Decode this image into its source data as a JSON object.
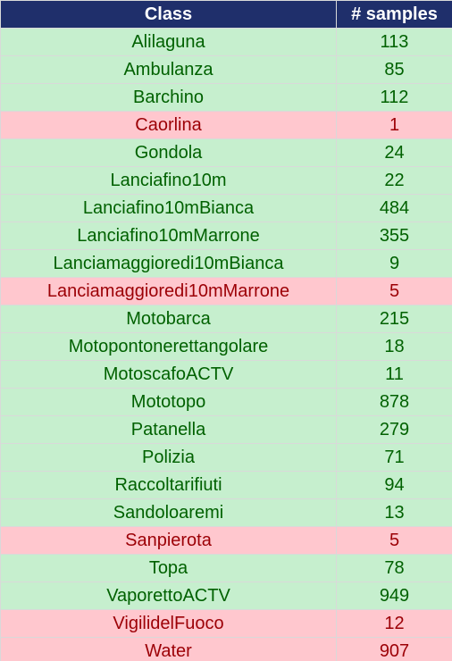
{
  "header": {
    "class_label": "Class",
    "samples_label": "# samples"
  },
  "colors": {
    "header_bg": "#1f2f6b",
    "good_bg": "#c6efce",
    "good_text": "#006100",
    "bad_bg": "#ffc7ce",
    "bad_text": "#9c0006"
  },
  "rows": [
    {
      "class": "Alilaguna",
      "samples": "113",
      "status": "good"
    },
    {
      "class": "Ambulanza",
      "samples": "85",
      "status": "good"
    },
    {
      "class": "Barchino",
      "samples": "112",
      "status": "good"
    },
    {
      "class": "Caorlina",
      "samples": "1",
      "status": "bad"
    },
    {
      "class": "Gondola",
      "samples": "24",
      "status": "good"
    },
    {
      "class": "Lanciafino10m",
      "samples": "22",
      "status": "good"
    },
    {
      "class": "Lanciafino10mBianca",
      "samples": "484",
      "status": "good"
    },
    {
      "class": "Lanciafino10mMarrone",
      "samples": "355",
      "status": "good"
    },
    {
      "class": "Lanciamaggioredi10mBianca",
      "samples": "9",
      "status": "good"
    },
    {
      "class": "Lanciamaggioredi10mMarrone",
      "samples": "5",
      "status": "bad"
    },
    {
      "class": "Motobarca",
      "samples": "215",
      "status": "good"
    },
    {
      "class": "Motopontonerettangolare",
      "samples": "18",
      "status": "good"
    },
    {
      "class": "MotoscafoACTV",
      "samples": "11",
      "status": "good"
    },
    {
      "class": "Mototopo",
      "samples": "878",
      "status": "good"
    },
    {
      "class": "Patanella",
      "samples": "279",
      "status": "good"
    },
    {
      "class": "Polizia",
      "samples": "71",
      "status": "good"
    },
    {
      "class": "Raccoltarifiuti",
      "samples": "94",
      "status": "good"
    },
    {
      "class": "Sandoloaremi",
      "samples": "13",
      "status": "good"
    },
    {
      "class": "Sanpierota",
      "samples": "5",
      "status": "bad"
    },
    {
      "class": "Topa",
      "samples": "78",
      "status": "good"
    },
    {
      "class": "VaporettoACTV",
      "samples": "949",
      "status": "good"
    },
    {
      "class": "VigilidelFuoco",
      "samples": "12",
      "status": "bad"
    },
    {
      "class": "Water",
      "samples": "907",
      "status": "bad"
    }
  ]
}
